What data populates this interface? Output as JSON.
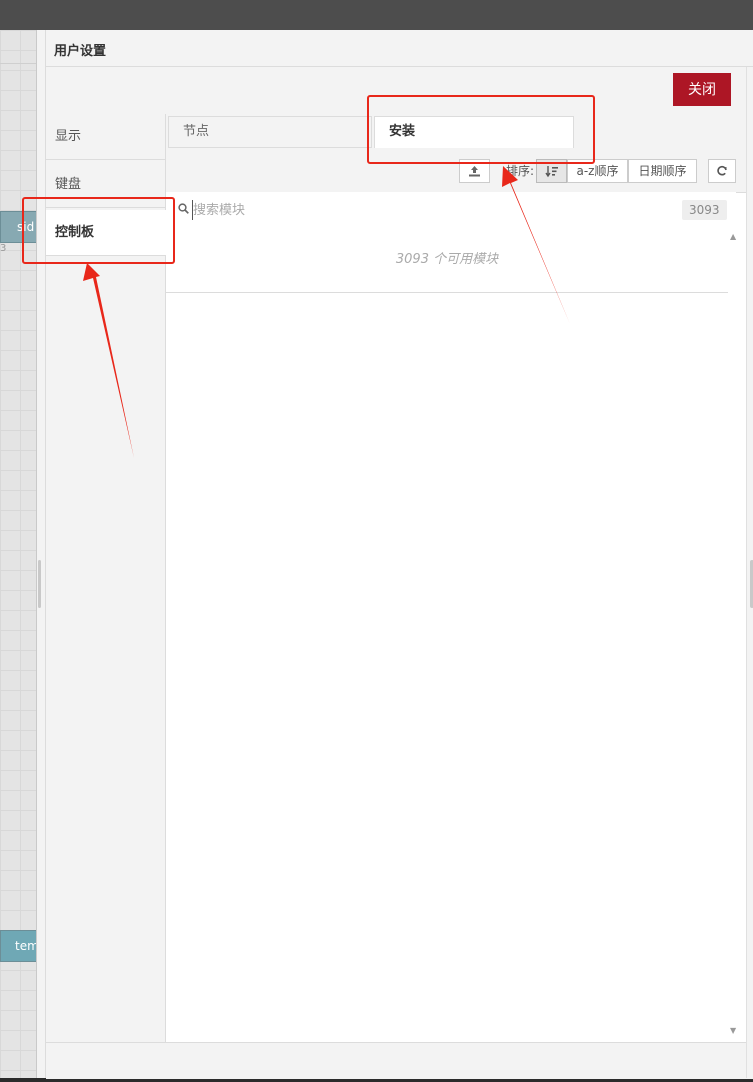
{
  "background": {
    "node_1_label": "sid",
    "node_1_port": "3",
    "node_2_label": "tem"
  },
  "dialog": {
    "title": "用户设置",
    "close_label": "关闭"
  },
  "sidebar": {
    "items": [
      {
        "label": "显示",
        "active": false
      },
      {
        "label": "键盘",
        "active": false
      },
      {
        "label": "控制板",
        "active": true
      }
    ]
  },
  "tabs": [
    {
      "label": "节点",
      "active": false
    },
    {
      "label": "安装",
      "active": true
    }
  ],
  "toolbar": {
    "upload_icon": "upload-icon",
    "sort_label": "排序:",
    "sort_direction_icon": "sort-descending-icon",
    "sort_az_label": "a-z顺序",
    "sort_date_label": "日期顺序",
    "refresh_icon": "refresh-icon"
  },
  "search": {
    "placeholder": "搜索模块",
    "value": "",
    "count": "3093"
  },
  "results": {
    "empty_message": "3093 个可用模块"
  },
  "colors": {
    "close_button": "#ad1625",
    "annotation": "#e8271a",
    "node": "#87a9b2"
  }
}
